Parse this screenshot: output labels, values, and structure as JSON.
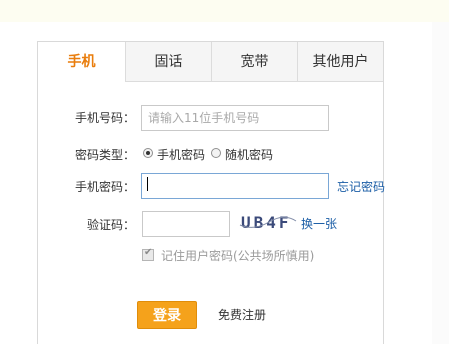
{
  "tabs": [
    {
      "label": "手机",
      "active": true
    },
    {
      "label": "固话",
      "active": false
    },
    {
      "label": "宽带",
      "active": false
    },
    {
      "label": "其他用户",
      "active": false
    }
  ],
  "form": {
    "phone_label": "手机号码：",
    "phone_placeholder": "请输入11位手机号码",
    "pwd_type_label": "密码类型：",
    "pwd_type_options": [
      "手机密码",
      "随机密码"
    ],
    "pwd_type_selected": "手机密码",
    "pwd_label": "手机密码：",
    "pwd_value": "",
    "forgot_link": "忘记密码",
    "captcha_label": "验证码：",
    "captcha_value": "",
    "captcha_text": "UB4F",
    "refresh_link": "换一张",
    "remember_label": "记住用户密码(公共场所慎用)",
    "remember_checked": true
  },
  "actions": {
    "login_label": "登录",
    "register_label": "免费注册"
  },
  "colors": {
    "accent": "#e97d0c",
    "button": "#f5a21b",
    "link": "#1a5da6"
  }
}
